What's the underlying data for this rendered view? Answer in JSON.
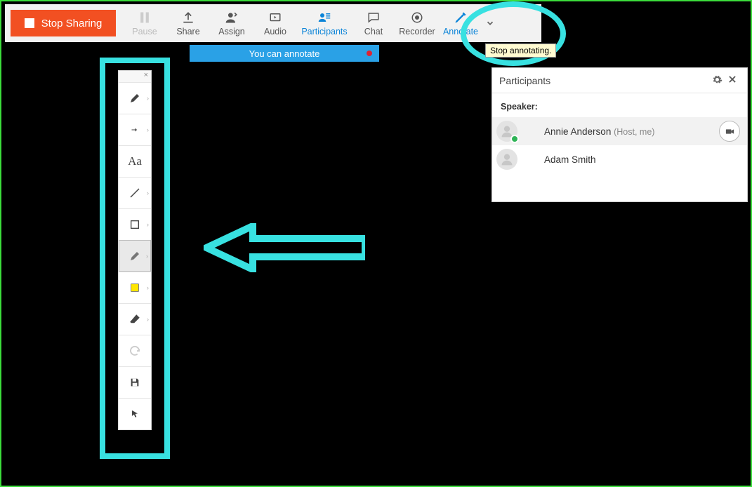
{
  "toolbar": {
    "stop_sharing": "Stop Sharing",
    "pause": "Pause",
    "share": "Share",
    "assign": "Assign",
    "audio": "Audio",
    "participants": "Participants",
    "chat": "Chat",
    "recorder": "Recorder",
    "annotate": "Annotate"
  },
  "tooltip": "Stop annotating.",
  "banner": "You can annotate",
  "participants_panel": {
    "title": "Participants",
    "subtitle": "Speaker:",
    "rows": [
      {
        "name": "Annie Anderson",
        "meta": "(Host, me)"
      },
      {
        "name": "Adam Smith",
        "meta": ""
      }
    ]
  },
  "palette": {
    "items": [
      "pen",
      "arrow",
      "text",
      "line",
      "rectangle",
      "highlighter",
      "fill",
      "eraser",
      "undo",
      "save",
      "pointer"
    ]
  }
}
